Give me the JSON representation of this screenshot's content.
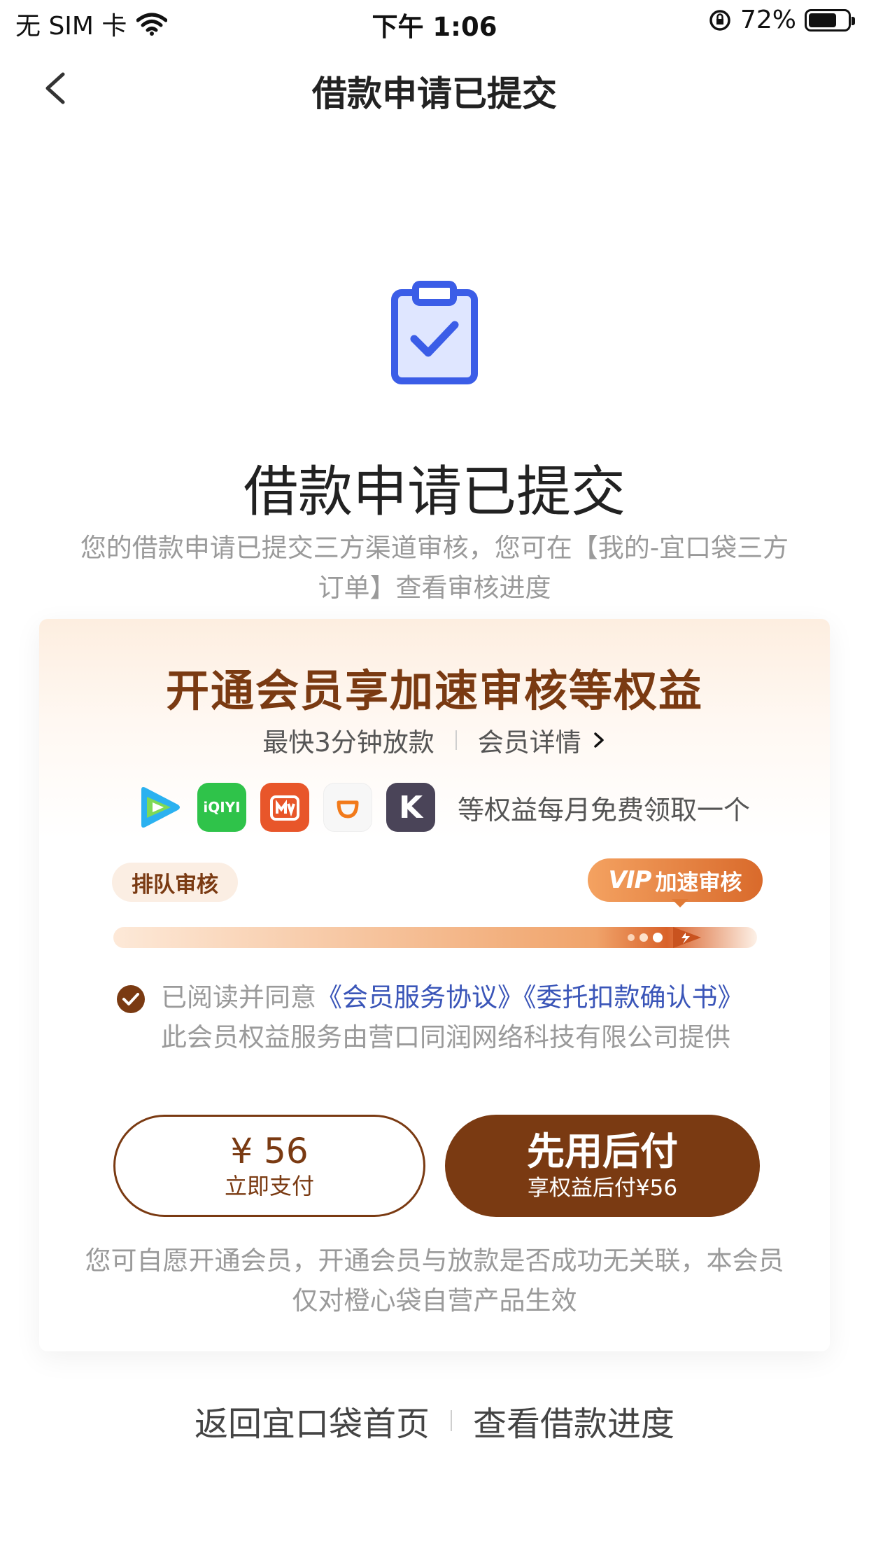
{
  "status_bar": {
    "carrier": "无 SIM 卡",
    "time": "下午 1:06",
    "battery_percent_text": "72%",
    "battery_level": 0.72
  },
  "nav": {
    "title": "借款申请已提交",
    "back_icon": "chevron-left-icon"
  },
  "hero": {
    "icon": "clipboard-check-icon",
    "title": "借款申请已提交",
    "description": "您的借款申请已提交三方渠道审核，您可在【我的-宜口袋三方订单】查看审核进度"
  },
  "membership_card": {
    "title": "开通会员享加速审核等权益",
    "speed_text": "最快3分钟放款",
    "details_link": "会员详情",
    "apps": [
      {
        "name": "tencent-video-icon"
      },
      {
        "name": "iqiyi-icon",
        "label": "iQIYI"
      },
      {
        "name": "mango-tv-icon"
      },
      {
        "name": "didi-icon"
      },
      {
        "name": "keep-icon",
        "label": "K"
      }
    ],
    "apps_text": "等权益每月免费领取一个",
    "queue_tag": "排队审核",
    "vip_tag_logo": "VIP",
    "vip_tag_text": "加速审核",
    "agreement": {
      "checked": true,
      "prefix": "已阅读并同意",
      "link1": "《会员服务协议》",
      "link2": "《委托扣款确认书》",
      "suffix": "此会员权益服务由营口同润网络科技有限公司提供"
    },
    "pay_button": {
      "amount": "¥ 56",
      "label": "立即支付"
    },
    "later_button": {
      "label": "先用后付",
      "sub": "享权益后付¥56"
    },
    "disclaimer": "您可自愿开通会员，开通会员与放款是否成功无关联，本会员仅对橙心袋自营产品生效"
  },
  "bottom_links": {
    "home": "返回宜口袋首页",
    "progress": "查看借款进度"
  },
  "colors": {
    "brand_brown": "#7a3a12",
    "link_blue": "#3a55b8",
    "icon_blue": "#3b5de7",
    "gray_text": "#9a9a9a"
  }
}
